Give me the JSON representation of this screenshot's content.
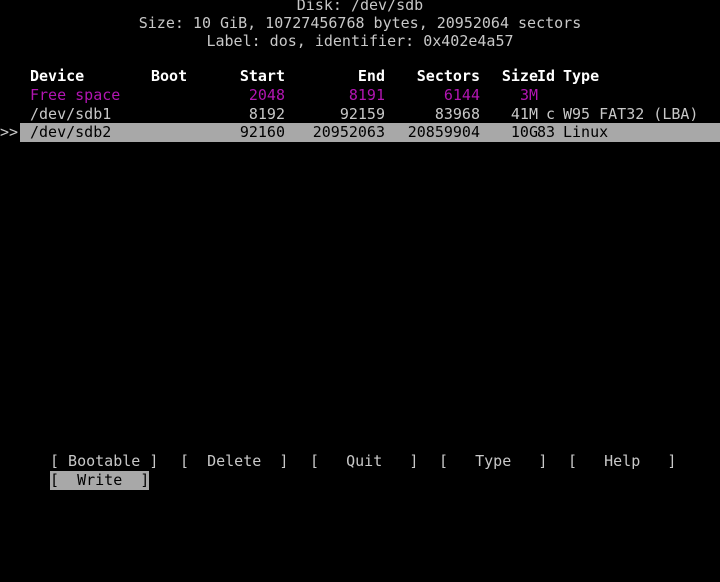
{
  "app": {
    "name": "cfdisk",
    "colors": {
      "background": "#000000",
      "foreground": "#c8c8c8",
      "header_text": "#ffffff",
      "free_space": "#b215b2",
      "highlight_bg": "#a8a8a8",
      "highlight_fg": "#000000"
    }
  },
  "header": {
    "disk_line": "Disk: /dev/sdb",
    "size_line": "Size: 10 GiB, 10727456768 bytes, 20952064 sectors",
    "label_line": "Label: dos, identifier: 0x402e4a57",
    "disk_path": "/dev/sdb",
    "size_human": "10 GiB",
    "size_bytes": "10727456768",
    "sectors_total": "20952064",
    "label_type": "dos",
    "identifier": "0x402e4a57"
  },
  "table": {
    "columns": [
      {
        "key": "device",
        "label": "Device"
      },
      {
        "key": "boot",
        "label": "Boot"
      },
      {
        "key": "start",
        "label": "Start"
      },
      {
        "key": "end",
        "label": "End"
      },
      {
        "key": "sectors",
        "label": "Sectors"
      },
      {
        "key": "size",
        "label": "Size"
      },
      {
        "key": "id",
        "label": "Id"
      },
      {
        "key": "type",
        "label": "Type"
      }
    ],
    "rows": [
      {
        "device": "Free space",
        "boot": "",
        "start": "2048",
        "end": "8191",
        "sectors": "6144",
        "size": "3M",
        "id": "",
        "type": "",
        "style": "free",
        "selected": false,
        "marker": ""
      },
      {
        "device": "/dev/sdb1",
        "boot": "",
        "start": "8192",
        "end": "92159",
        "sectors": "83968",
        "size": "41M",
        "id": "c",
        "type": "W95 FAT32 (LBA)",
        "style": "normal",
        "selected": false,
        "marker": ""
      },
      {
        "device": "/dev/sdb2",
        "boot": "",
        "start": "92160",
        "end": "20952063",
        "sectors": "20859904",
        "size": "10G",
        "id": "83",
        "type": "Linux",
        "style": "normal",
        "selected": true,
        "marker": ">>"
      }
    ]
  },
  "menu": {
    "row1": [
      {
        "label": "Bootable",
        "bracket_open": "[",
        "bracket_close": "]",
        "selected": false
      },
      {
        "label": "Delete",
        "bracket_open": "[",
        "bracket_close": "]",
        "selected": false
      },
      {
        "label": "Quit",
        "bracket_open": "[",
        "bracket_close": "]",
        "selected": false
      },
      {
        "label": "Type",
        "bracket_open": "[",
        "bracket_close": "]",
        "selected": false
      },
      {
        "label": "Help",
        "bracket_open": "[",
        "bracket_close": "]",
        "selected": false
      }
    ],
    "row2": [
      {
        "label": "Write",
        "bracket_open": "[",
        "bracket_close": "]",
        "selected": true
      }
    ],
    "items_rendered": {
      "bootable": "[ Bootable ]",
      "delete": "[  Delete  ]",
      "quit": "[   Quit   ]",
      "type": "[   Type   ]",
      "help": "[   Help   ]",
      "write": "[  Write  ]"
    }
  }
}
